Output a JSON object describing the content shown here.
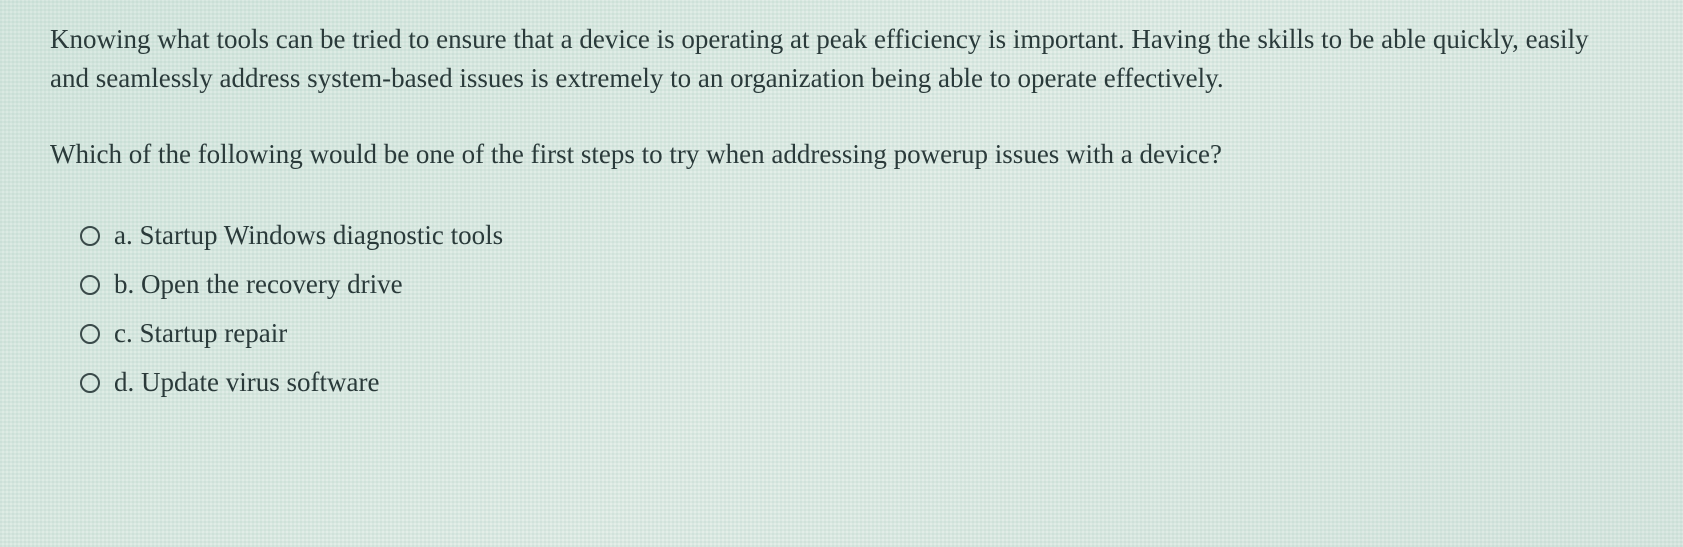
{
  "intro": "Knowing what tools can be tried to ensure that a device is operating at peak efficiency is important. Having the skills to be able quickly, easily and seamlessly address system-based issues is extremely to an organization being able to operate effectively.",
  "question": "Which of the following would be one of the first steps to try when addressing powerup issues with a device?",
  "options": [
    {
      "letter": "a.",
      "text": "Startup Windows diagnostic tools"
    },
    {
      "letter": "b.",
      "text": "Open the recovery drive"
    },
    {
      "letter": "c.",
      "text": "Startup repair"
    },
    {
      "letter": "d.",
      "text": "Update virus software"
    }
  ]
}
